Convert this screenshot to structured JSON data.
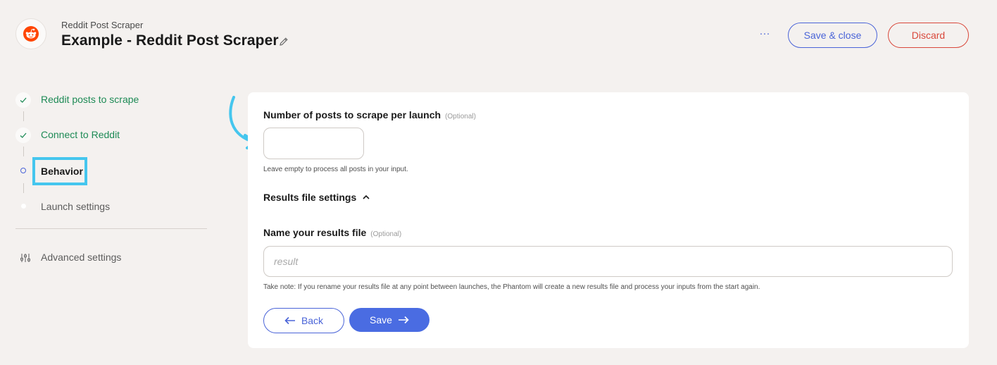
{
  "header": {
    "app_subtitle": "Reddit Post Scraper",
    "title": "Example - Reddit Post Scraper",
    "more_label": "···",
    "save_close_label": "Save & close",
    "discard_label": "Discard",
    "icons": {
      "logo": "reddit-logo-icon",
      "edit": "pencil-icon"
    }
  },
  "sidebar": {
    "steps": [
      {
        "label": "Reddit posts to scrape",
        "status": "done"
      },
      {
        "label": "Connect to Reddit",
        "status": "done"
      },
      {
        "label": "Behavior",
        "status": "active"
      },
      {
        "label": "Launch settings",
        "status": "todo"
      }
    ],
    "advanced_label": "Advanced settings"
  },
  "form": {
    "posts_per_launch": {
      "label": "Number of posts to scrape per launch",
      "optional": "(Optional)",
      "value": "",
      "placeholder": "",
      "hint": "Leave empty to process all posts in your input."
    },
    "results_section_label": "Results file settings",
    "results_file": {
      "label": "Name your results file",
      "optional": "(Optional)",
      "value": "",
      "placeholder": "result",
      "hint": "Take note: If you rename your results file at any point between launches, the Phantom will create a new results file and process your inputs from the start again."
    },
    "back_label": "Back",
    "save_label": "Save"
  },
  "colors": {
    "background": "#f4f1ef",
    "primary": "#4a6ce2",
    "danger": "#d9483b",
    "success": "#1d8a55",
    "highlight": "#45c6ee"
  }
}
